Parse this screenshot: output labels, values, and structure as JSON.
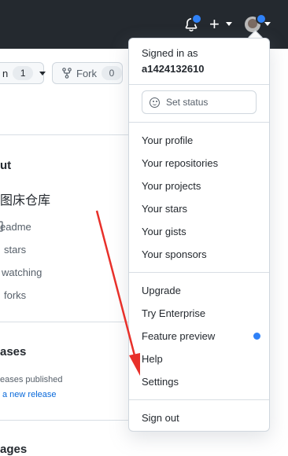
{
  "header": {
    "bell_icon": "bell-icon",
    "plus_label": "+",
    "avatar_icon": "avatar"
  },
  "repo_actions": {
    "watch_label": "n",
    "watch_count": "1",
    "fork_label": "Fork",
    "fork_count": "0"
  },
  "sidebar": {
    "about_heading": "ut",
    "description": "图床仓库",
    "links": [
      "eadme",
      "stars",
      "watching",
      "forks"
    ],
    "releases_heading": "ases",
    "releases_status": "eases published",
    "new_release_link": "a new release",
    "packages_heading": "ages"
  },
  "menu": {
    "signed_in_as": "Signed in as",
    "username": "a1424132610",
    "set_status": "Set status",
    "group1": [
      "Your profile",
      "Your repositories",
      "Your projects",
      "Your stars",
      "Your gists",
      "Your sponsors"
    ],
    "group2": [
      "Upgrade",
      "Try Enterprise",
      "Feature preview",
      "Help",
      "Settings"
    ],
    "sign_out": "Sign out"
  },
  "colors": {
    "header_bg": "#24292f",
    "notification_dot": "#2f81f7",
    "annotation_arrow": "#e8302a"
  }
}
